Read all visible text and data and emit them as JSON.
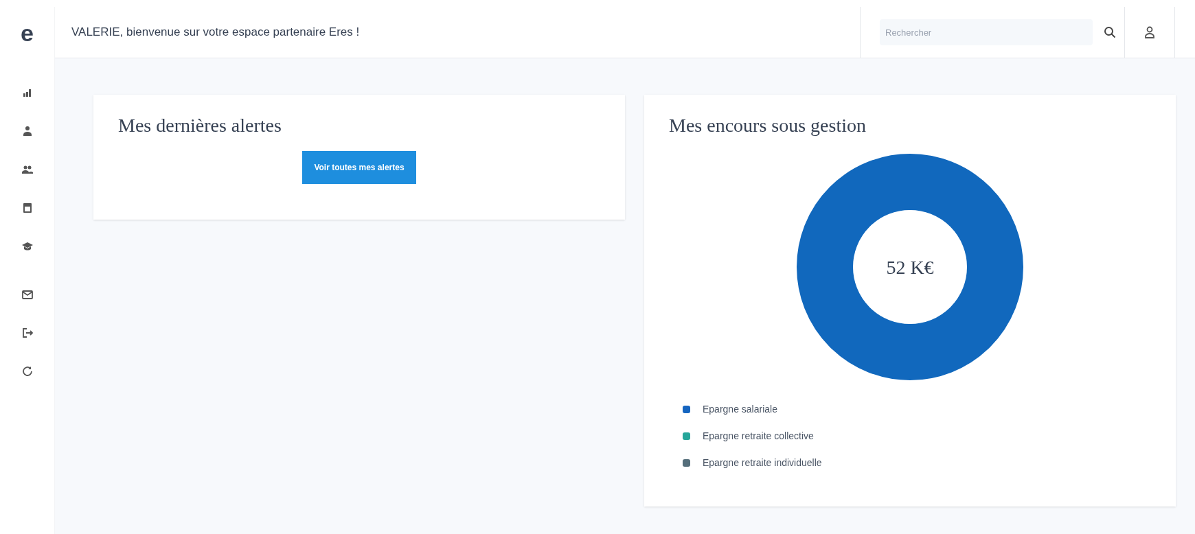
{
  "header": {
    "logo": "e",
    "welcome": "VALERIE, bienvenue sur votre espace partenaire Eres !",
    "search": {
      "placeholder": "Rechercher"
    }
  },
  "sidebar": {
    "items": [
      {
        "kind": "chart"
      },
      {
        "kind": "user"
      },
      {
        "kind": "users"
      },
      {
        "kind": "calendar"
      },
      {
        "kind": "cap"
      },
      {
        "kind": "mail"
      },
      {
        "kind": "logout"
      },
      {
        "kind": "refresh"
      }
    ]
  },
  "alerts_card": {
    "title": "Mes dernières alertes",
    "button": "Voir toutes mes alertes"
  },
  "holdings_card": {
    "title": "Mes encours sous gestion",
    "total": "52 K€",
    "legend": [
      {
        "label": "Epargne salariale",
        "color": "#1565c0"
      },
      {
        "label": "Epargne retraite collective",
        "color": "#26a69a"
      },
      {
        "label": "Epargne retraite individuelle",
        "color": "#546e7a"
      }
    ]
  }
}
